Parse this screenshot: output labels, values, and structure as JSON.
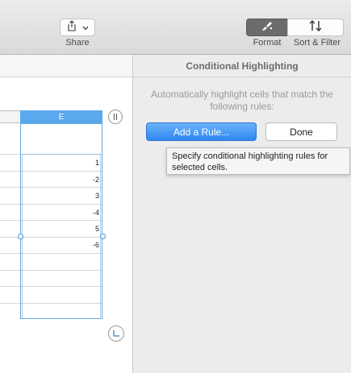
{
  "toolbar": {
    "share_label": "Share",
    "format_label": "Format",
    "sort_filter_label": "Sort & Filter"
  },
  "sheet": {
    "selected_column_header": "E",
    "cells": [
      "1",
      "-2",
      "3",
      "-4",
      "5",
      "-6"
    ]
  },
  "panel": {
    "title": "Conditional Highlighting",
    "description": "Automatically highlight cells that match the following rules:",
    "add_rule_label": "Add a Rule...",
    "done_label": "Done"
  },
  "tooltip": {
    "text": "Specify conditional highlighting rules for selected cells."
  },
  "icons": {
    "share": "share-icon",
    "chevron": "chevron-down-icon",
    "format": "paintbrush-icon",
    "sort": "sort-arrows-icon",
    "column_handle": "column-resize-icon",
    "corner_handle": "corner-resize-icon"
  },
  "colors": {
    "accent": "#2f86f0",
    "selected_header": "#5aa8ee",
    "format_active": "#6b6b6b"
  }
}
